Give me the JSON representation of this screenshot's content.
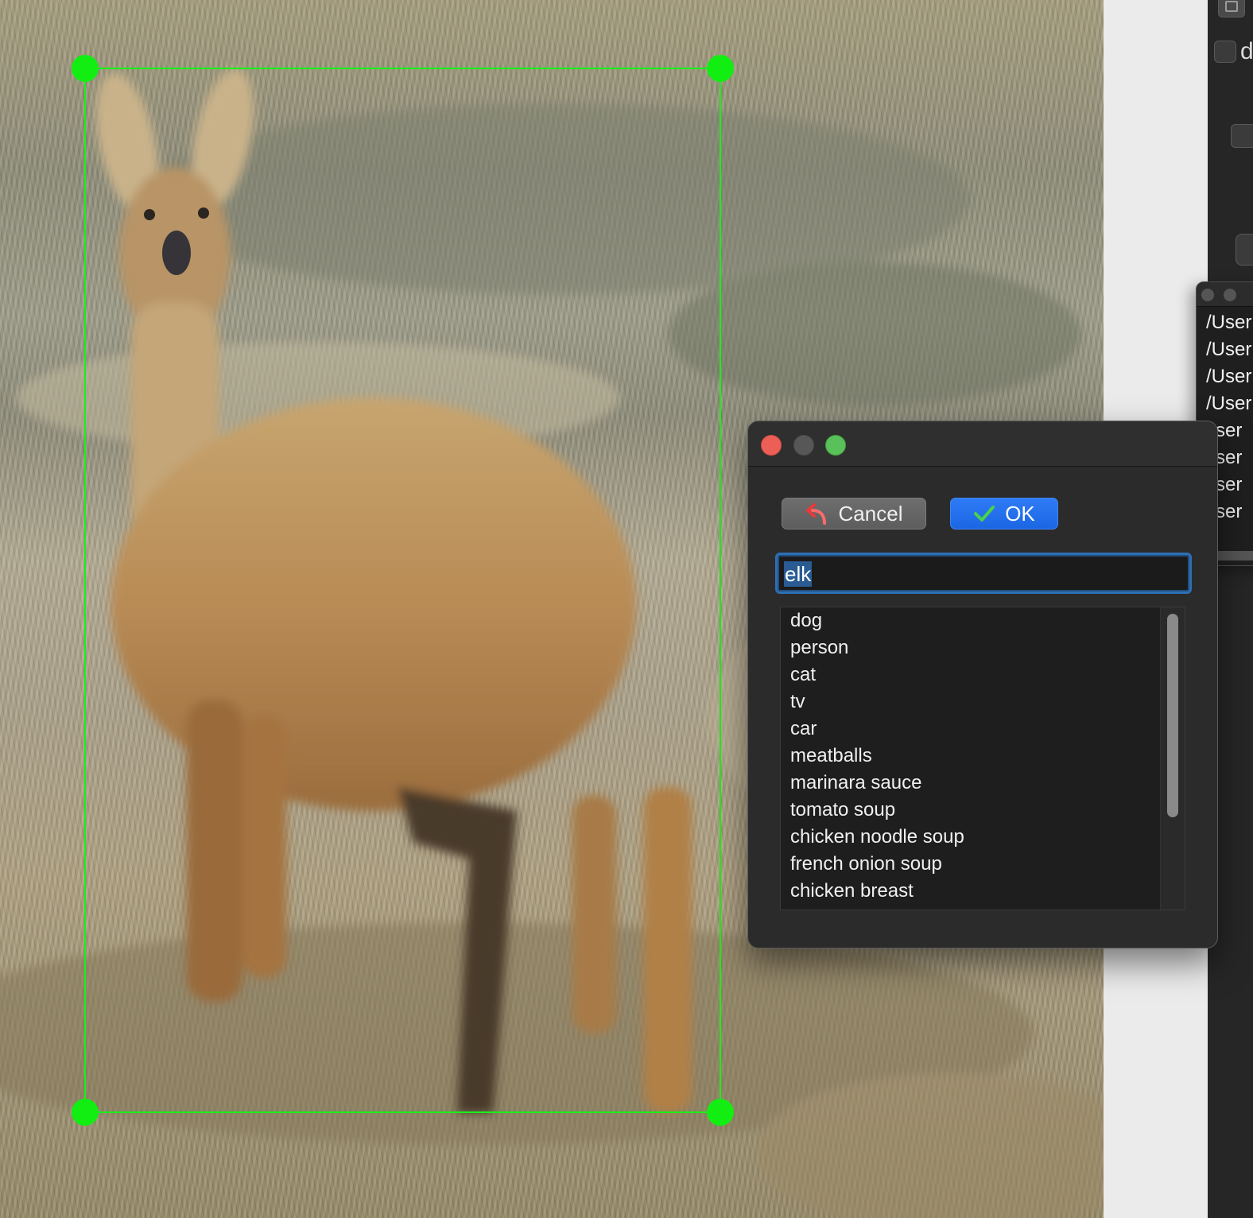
{
  "dialog": {
    "cancel_label": "Cancel",
    "ok_label": "OK",
    "input_value": "elk",
    "suggestions": [
      "dog",
      "person",
      "cat",
      "tv",
      "car",
      "meatballs",
      "marinara sauce",
      "tomato soup",
      "chicken noodle soup",
      "french onion soup",
      "chicken breast"
    ]
  },
  "side_panel": {
    "checkbox_label": "d",
    "file_paths": [
      "/User",
      "/User",
      "/User",
      "/User",
      "Jser",
      "Jser",
      "Jser",
      "Jser"
    ]
  },
  "colors": {
    "bbox": "#18f018",
    "ok_button": "#1b66e3",
    "close_button": "#ec5f57",
    "zoom_button": "#5ac05a"
  },
  "icons": {
    "cancel": "undo-arrow-icon",
    "ok": "checkmark-icon"
  }
}
